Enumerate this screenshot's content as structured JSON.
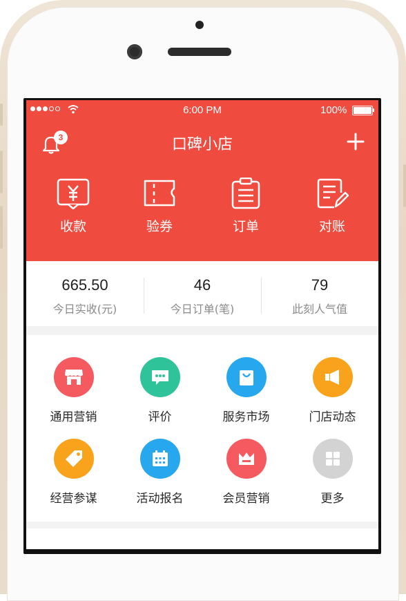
{
  "status_bar": {
    "time": "6:00 PM",
    "battery": "100%",
    "signal_icon": "signal-dots-icon",
    "wifi_icon": "wifi-icon"
  },
  "header": {
    "title": "口碑小店",
    "notification_badge": "3",
    "bell_icon": "bell-icon",
    "plus_icon": "plus-icon"
  },
  "quick_actions": [
    {
      "label": "收款",
      "icon": "receive-payment-icon"
    },
    {
      "label": "验券",
      "icon": "ticket-icon"
    },
    {
      "label": "订单",
      "icon": "clipboard-icon"
    },
    {
      "label": "对账",
      "icon": "reconcile-icon"
    }
  ],
  "stats": [
    {
      "value": "665.50",
      "label": "今日实收(元)"
    },
    {
      "value": "46",
      "label": "今日订单(笔)"
    },
    {
      "value": "79",
      "label": "此刻人气值"
    }
  ],
  "features": [
    {
      "label": "通用营销",
      "icon": "shop-icon",
      "color": "#f45a5f"
    },
    {
      "label": "评价",
      "icon": "chat-icon",
      "color": "#2fc39a"
    },
    {
      "label": "服务市场",
      "icon": "shopping-bag-icon",
      "color": "#27a8ee"
    },
    {
      "label": "门店动态",
      "icon": "megaphone-icon",
      "color": "#f9a21b"
    },
    {
      "label": "经营参谋",
      "icon": "tag-icon",
      "color": "#f9a21b"
    },
    {
      "label": "活动报名",
      "icon": "calendar-icon",
      "color": "#27a8ee"
    },
    {
      "label": "会员营销",
      "icon": "crown-icon",
      "color": "#f45a5f"
    },
    {
      "label": "更多",
      "icon": "grid-icon",
      "color": "#d3d3d3"
    }
  ],
  "colors": {
    "brand_red": "#f04b3f",
    "frame_gold": "#e8dccb"
  }
}
